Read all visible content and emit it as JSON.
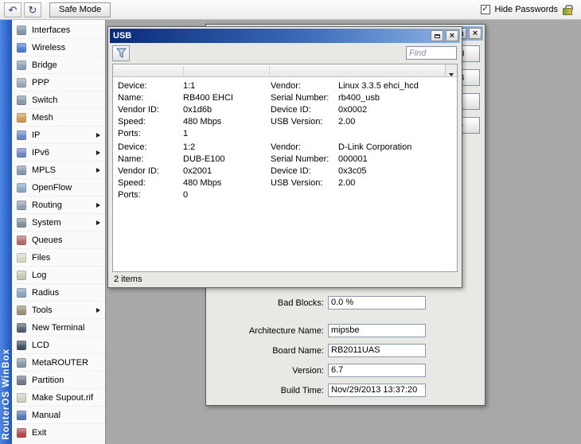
{
  "toolbar": {
    "undo_glyph": "↶",
    "redo_glyph": "↻",
    "safe_mode_label": "Safe Mode",
    "hide_passwords_label": "Hide Passwords",
    "hide_passwords_checked": "✓"
  },
  "chrome": {
    "close_glyph": "×"
  },
  "branding": {
    "vertical_text": "RouterOS WinBox"
  },
  "sidebar": {
    "items": [
      {
        "label": "Interfaces",
        "icon": "interfaces-icon",
        "color": "#8296ad",
        "submenu": false
      },
      {
        "label": "Wireless",
        "icon": "wireless-icon",
        "color": "#4a7fd4",
        "submenu": false
      },
      {
        "label": "Bridge",
        "icon": "bridge-icon",
        "color": "#8aa0b8",
        "submenu": false
      },
      {
        "label": "PPP",
        "icon": "ppp-icon",
        "color": "#9aa8b8",
        "submenu": false
      },
      {
        "label": "Switch",
        "icon": "switch-icon",
        "color": "#8898aa",
        "submenu": false
      },
      {
        "label": "Mesh",
        "icon": "mesh-icon",
        "color": "#d29a50",
        "submenu": false
      },
      {
        "label": "IP",
        "icon": "ip-icon",
        "color": "#6a88c8",
        "submenu": true
      },
      {
        "label": "IPv6",
        "icon": "ipv6-icon",
        "color": "#6a88c8",
        "submenu": true
      },
      {
        "label": "MPLS",
        "icon": "mpls-icon",
        "color": "#8898aa",
        "submenu": true
      },
      {
        "label": "OpenFlow",
        "icon": "openflow-icon",
        "color": "#88a8c8",
        "submenu": false
      },
      {
        "label": "Routing",
        "icon": "routing-icon",
        "color": "#90a0b0",
        "submenu": true
      },
      {
        "label": "System",
        "icon": "system-icon",
        "color": "#8090a0",
        "submenu": true
      },
      {
        "label": "Queues",
        "icon": "queues-icon",
        "color": "#b86a6a",
        "submenu": false
      },
      {
        "label": "Files",
        "icon": "files-icon",
        "color": "#d8d8c8",
        "submenu": false
      },
      {
        "label": "Log",
        "icon": "log-icon",
        "color": "#c8c8b0",
        "submenu": false
      },
      {
        "label": "Radius",
        "icon": "radius-icon",
        "color": "#88a0c0",
        "submenu": false
      },
      {
        "label": "Tools",
        "icon": "tools-icon",
        "color": "#a09078",
        "submenu": true
      },
      {
        "label": "New Terminal",
        "icon": "terminal-icon",
        "color": "#506070",
        "submenu": false
      },
      {
        "label": "LCD",
        "icon": "lcd-icon",
        "color": "#405060",
        "submenu": false
      },
      {
        "label": "MetaROUTER",
        "icon": "metarouter-icon",
        "color": "#8898a8",
        "submenu": false
      },
      {
        "label": "Partition",
        "icon": "partition-icon",
        "color": "#707888",
        "submenu": false
      },
      {
        "label": "Make Supout.rif",
        "icon": "supout-icon",
        "color": "#d0d0c0",
        "submenu": false
      },
      {
        "label": "Manual",
        "icon": "manual-icon",
        "color": "#5878b8",
        "submenu": false
      },
      {
        "label": "Exit",
        "icon": "exit-icon",
        "color": "#b04848",
        "submenu": false
      }
    ]
  },
  "usb_window": {
    "title": "USB",
    "find_placeholder": "Find",
    "status": "2 items",
    "devices": [
      {
        "left": [
          [
            "Device:",
            "1:1"
          ],
          [
            "Name:",
            "RB400 EHCI"
          ],
          [
            "Vendor ID:",
            "0x1d6b"
          ],
          [
            "Speed:",
            "480 Mbps"
          ],
          [
            "Ports:",
            "1"
          ]
        ],
        "right": [
          [
            "Vendor:",
            "Linux 3.3.5 ehci_hcd"
          ],
          [
            "Serial Number:",
            "rb400_usb"
          ],
          [
            "Device ID:",
            "0x0002"
          ],
          [
            "USB Version:",
            "2.00"
          ]
        ]
      },
      {
        "left": [
          [
            "Device:",
            "1:2"
          ],
          [
            "Name:",
            "DUB-E100"
          ],
          [
            "Vendor ID:",
            "0x2001"
          ],
          [
            "Speed:",
            "480 Mbps"
          ],
          [
            "Ports:",
            "0"
          ]
        ],
        "right": [
          [
            "Vendor:",
            "D-Link Corporation"
          ],
          [
            "Serial Number:",
            "000001"
          ],
          [
            "Device ID:",
            "0x3c05"
          ],
          [
            "USB Version:",
            "2.00"
          ]
        ]
      }
    ]
  },
  "resources_window": {
    "title": "",
    "buttons": [
      "CPU",
      "USB",
      "PCI",
      "IRQ"
    ],
    "fields": [
      [
        "Bad Blocks:",
        "0.0 %"
      ],
      [
        "Architecture Name:",
        "mipsbe"
      ],
      [
        "Board Name:",
        "RB2011UAS"
      ],
      [
        "Version:",
        "6.7"
      ],
      [
        "Build Time:",
        "Nov/29/2013 13:37:20"
      ]
    ]
  }
}
